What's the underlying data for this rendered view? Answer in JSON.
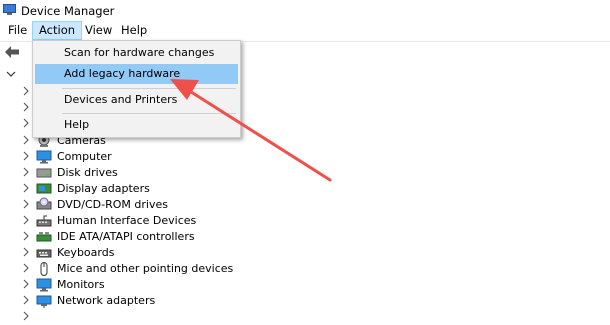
{
  "window": {
    "title": "Device Manager"
  },
  "menubar": {
    "items": [
      "File",
      "Action",
      "View",
      "Help"
    ],
    "active": "Action"
  },
  "action_menu": {
    "items": [
      {
        "label": "Scan for hardware changes",
        "highlighted": false
      },
      {
        "label": "Add legacy hardware",
        "highlighted": true
      },
      {
        "label": "Devices and Printers",
        "highlighted": false
      },
      {
        "label": "Help",
        "highlighted": false
      }
    ]
  },
  "tree": {
    "categories": [
      {
        "label": "Cameras",
        "icon": "camera-icon"
      },
      {
        "label": "Computer",
        "icon": "computer-icon"
      },
      {
        "label": "Disk drives",
        "icon": "disk-drive-icon"
      },
      {
        "label": "Display adapters",
        "icon": "display-adapter-icon"
      },
      {
        "label": "DVD/CD-ROM drives",
        "icon": "dvd-drive-icon"
      },
      {
        "label": "Human Interface Devices",
        "icon": "hid-icon"
      },
      {
        "label": "IDE ATA/ATAPI controllers",
        "icon": "ide-controller-icon"
      },
      {
        "label": "Keyboards",
        "icon": "keyboard-icon"
      },
      {
        "label": "Mice and other pointing devices",
        "icon": "mouse-icon"
      },
      {
        "label": "Monitors",
        "icon": "monitor-icon"
      },
      {
        "label": "Network adapters",
        "icon": "network-adapter-icon"
      }
    ]
  },
  "colors": {
    "menu_highlight": "#91c9f7",
    "menubar_active": "#cce8ff",
    "annotation_arrow": "#f0504a"
  }
}
